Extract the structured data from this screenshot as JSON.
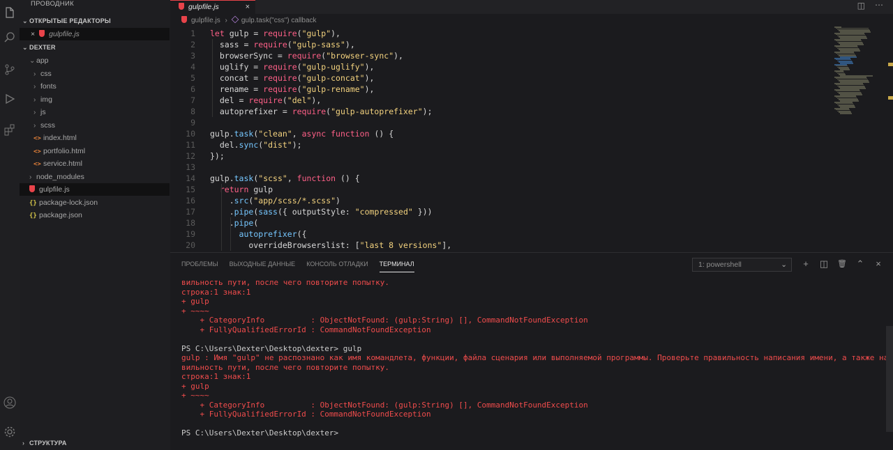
{
  "explorer": {
    "title": "ПРОВОДНИК",
    "open_editors_label": "ОТКРЫТЫЕ РЕДАКТОРЫ",
    "open_editor": {
      "close": "×",
      "name": "gulpfile.js"
    },
    "project_label": "DEXTER",
    "tree": [
      {
        "label": "app",
        "kind": "folder-open",
        "depth": 1
      },
      {
        "label": "css",
        "kind": "folder",
        "depth": 2
      },
      {
        "label": "fonts",
        "kind": "folder",
        "depth": 2
      },
      {
        "label": "img",
        "kind": "folder",
        "depth": 2
      },
      {
        "label": "js",
        "kind": "folder",
        "depth": 2
      },
      {
        "label": "scss",
        "kind": "folder",
        "depth": 2
      },
      {
        "label": "index.html",
        "kind": "html",
        "depth": 2
      },
      {
        "label": "portfolio.html",
        "kind": "html",
        "depth": 2
      },
      {
        "label": "service.html",
        "kind": "html",
        "depth": 2
      },
      {
        "label": "node_modules",
        "kind": "folder",
        "depth": 1
      },
      {
        "label": "gulpfile.js",
        "kind": "gulp",
        "depth": 1,
        "selected": true
      },
      {
        "label": "package-lock.json",
        "kind": "json",
        "depth": 1
      },
      {
        "label": "package.json",
        "kind": "json",
        "depth": 1
      }
    ],
    "outline_label": "СТРУКТУРА",
    "html_glyph": "<>",
    "json_glyph": "{}",
    "chevron_open": "⌄",
    "chevron_closed": "›"
  },
  "editor": {
    "tab": {
      "name": "gulpfile.js",
      "close": "×"
    },
    "breadcrumb": {
      "file": "gulpfile.js",
      "separator": "›",
      "symbol": "gulp.task(\"css\") callback"
    },
    "lines": [
      [
        [
          "let",
          "k"
        ],
        [
          " gulp = ",
          "p"
        ],
        [
          "require",
          "k"
        ],
        [
          "(",
          "p"
        ],
        [
          "\"gulp\"",
          "s"
        ],
        [
          "),",
          "p"
        ]
      ],
      [
        [
          "  sass = ",
          "p"
        ],
        [
          "require",
          "k"
        ],
        [
          "(",
          "p"
        ],
        [
          "\"gulp-sass\"",
          "s"
        ],
        [
          "),",
          "p"
        ]
      ],
      [
        [
          "  browserSync = ",
          "p"
        ],
        [
          "require",
          "k"
        ],
        [
          "(",
          "p"
        ],
        [
          "\"browser-sync\"",
          "s"
        ],
        [
          "),",
          "p"
        ]
      ],
      [
        [
          "  uglify = ",
          "p"
        ],
        [
          "require",
          "k"
        ],
        [
          "(",
          "p"
        ],
        [
          "\"gulp-uglify\"",
          "s"
        ],
        [
          "),",
          "p"
        ]
      ],
      [
        [
          "  concat = ",
          "p"
        ],
        [
          "require",
          "k"
        ],
        [
          "(",
          "p"
        ],
        [
          "\"gulp-concat\"",
          "s"
        ],
        [
          "),",
          "p"
        ]
      ],
      [
        [
          "  rename = ",
          "p"
        ],
        [
          "require",
          "k"
        ],
        [
          "(",
          "p"
        ],
        [
          "\"gulp-rename\"",
          "s"
        ],
        [
          "),",
          "p"
        ]
      ],
      [
        [
          "  del = ",
          "p"
        ],
        [
          "require",
          "k"
        ],
        [
          "(",
          "p"
        ],
        [
          "\"del\"",
          "s"
        ],
        [
          "),",
          "p"
        ]
      ],
      [
        [
          "  autoprefixer = ",
          "p"
        ],
        [
          "require",
          "k"
        ],
        [
          "(",
          "p"
        ],
        [
          "\"gulp-autoprefixer\"",
          "s"
        ],
        [
          ");",
          "p"
        ]
      ],
      [],
      [
        [
          "gulp.",
          "p"
        ],
        [
          "task",
          "f"
        ],
        [
          "(",
          "p"
        ],
        [
          "\"clean\"",
          "s"
        ],
        [
          ", ",
          "p"
        ],
        [
          "async function",
          "k"
        ],
        [
          " () {",
          "p"
        ]
      ],
      [
        [
          "  del.",
          "p"
        ],
        [
          "sync",
          "f"
        ],
        [
          "(",
          "p"
        ],
        [
          "\"dist\"",
          "s"
        ],
        [
          ");",
          "p"
        ]
      ],
      [
        [
          "});",
          "p"
        ]
      ],
      [],
      [
        [
          "gulp.",
          "p"
        ],
        [
          "task",
          "f"
        ],
        [
          "(",
          "p"
        ],
        [
          "\"scss\"",
          "s"
        ],
        [
          ", ",
          "p"
        ],
        [
          "function",
          "k"
        ],
        [
          " () {",
          "p"
        ]
      ],
      [
        [
          "  ",
          "p"
        ],
        [
          "return",
          "k"
        ],
        [
          " gulp",
          "p"
        ]
      ],
      [
        [
          "    .",
          "p"
        ],
        [
          "src",
          "f"
        ],
        [
          "(",
          "p"
        ],
        [
          "\"app/scss/*.scss\"",
          "s"
        ],
        [
          ")",
          "p"
        ]
      ],
      [
        [
          "    .",
          "p"
        ],
        [
          "pipe",
          "f"
        ],
        [
          "(",
          "p"
        ],
        [
          "sass",
          "f"
        ],
        [
          "({ outputStyle: ",
          "p"
        ],
        [
          "\"compressed\"",
          "s"
        ],
        [
          " }))",
          "p"
        ]
      ],
      [
        [
          "    .",
          "p"
        ],
        [
          "pipe",
          "f"
        ],
        [
          "(",
          "p"
        ]
      ],
      [
        [
          "      ",
          "p"
        ],
        [
          "autoprefixer",
          "f"
        ],
        [
          "({",
          "p"
        ]
      ],
      [
        [
          "        overrideBrowserslist: [",
          "p"
        ],
        [
          "\"last 8 versions\"",
          "s"
        ],
        [
          "],",
          "p"
        ]
      ]
    ]
  },
  "panel": {
    "tabs": [
      {
        "label": "ПРОБЛЕМЫ",
        "active": false
      },
      {
        "label": "ВЫХОДНЫЕ ДАННЫЕ",
        "active": false
      },
      {
        "label": "КОНСОЛЬ ОТЛАДКИ",
        "active": false
      },
      {
        "label": "ТЕРМИНАЛ",
        "active": true
      }
    ],
    "shell": "1: powershell",
    "buttons": {
      "add": "+",
      "split": "◫",
      "trash": "🗑",
      "maximize": "⌃",
      "close": "×"
    }
  },
  "terminal": [
    {
      "t": "вильность пути, после чего повторите попытку.",
      "c": "err"
    },
    {
      "t": "строка:1 знак:1",
      "c": "err"
    },
    {
      "t": "+ gulp",
      "c": "err"
    },
    {
      "t": "+ ~~~~",
      "c": "err"
    },
    {
      "t": "    + CategoryInfo          : ObjectNotFound: (gulp:String) [], CommandNotFoundException",
      "c": "err"
    },
    {
      "t": "    + FullyQualifiedErrorId : CommandNotFoundException",
      "c": "err"
    },
    {
      "t": "",
      "c": "ps"
    },
    {
      "t": "PS C:\\Users\\Dexter\\Desktop\\dexter> gulp",
      "c": "ps"
    },
    {
      "t": "gulp : Имя \"gulp\" не распознано как имя командлета, функции, файла сценария или выполняемой программы. Проверьте правильность написания имени, а также наличие и пра",
      "c": "err"
    },
    {
      "t": "вильность пути, после чего повторите попытку.",
      "c": "err"
    },
    {
      "t": "строка:1 знак:1",
      "c": "err"
    },
    {
      "t": "+ gulp",
      "c": "err"
    },
    {
      "t": "+ ~~~~",
      "c": "err"
    },
    {
      "t": "    + CategoryInfo          : ObjectNotFound: (gulp:String) [], CommandNotFoundException",
      "c": "err"
    },
    {
      "t": "    + FullyQualifiedErrorId : CommandNotFoundException",
      "c": "err"
    },
    {
      "t": "",
      "c": "ps"
    },
    {
      "t": "PS C:\\Users\\Dexter\\Desktop\\dexter>",
      "c": "ps"
    }
  ],
  "colors": {
    "accent": "#e8434a",
    "error": "#f14c4c",
    "keyword": "#ff6088",
    "function": "#76c7ff",
    "string": "#f3d27e"
  }
}
